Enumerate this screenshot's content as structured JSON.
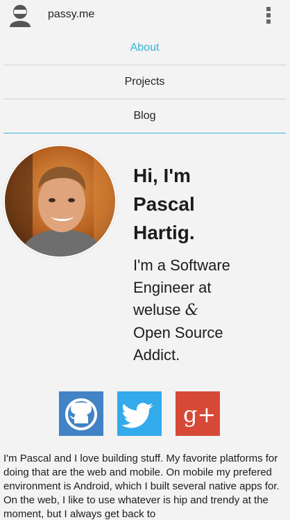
{
  "app": {
    "title": "passy.me"
  },
  "nav": {
    "items": [
      {
        "label": "About",
        "active": true
      },
      {
        "label": "Projects",
        "active": false
      },
      {
        "label": "Blog",
        "active": false
      }
    ]
  },
  "profile": {
    "greeting_line1": "Hi, I'm",
    "greeting_line2": "Pascal",
    "greeting_line3": "Hartig.",
    "tagline_line1": "I'm a Software",
    "tagline_line2": "Engineer at",
    "tagline_company": "weluse",
    "tagline_amp": "&",
    "tagline_line4": "Open Source",
    "tagline_line5": "Addict."
  },
  "social": {
    "github_color": "#4183c4",
    "twitter_color": "#33aaea",
    "googleplus_color": "#d64937",
    "googleplus_label": "g+"
  },
  "bio": {
    "text": "I'm Pascal and I love building stuff. My favorite platforms for doing that are the web and mobile. On mobile my prefered environment is Android, which I built several native apps for. On the web, I like to use whatever is hip and trendy at the moment, but I always get back to"
  },
  "colors": {
    "accent": "#35b3d2",
    "background": "#f3f3f3"
  }
}
